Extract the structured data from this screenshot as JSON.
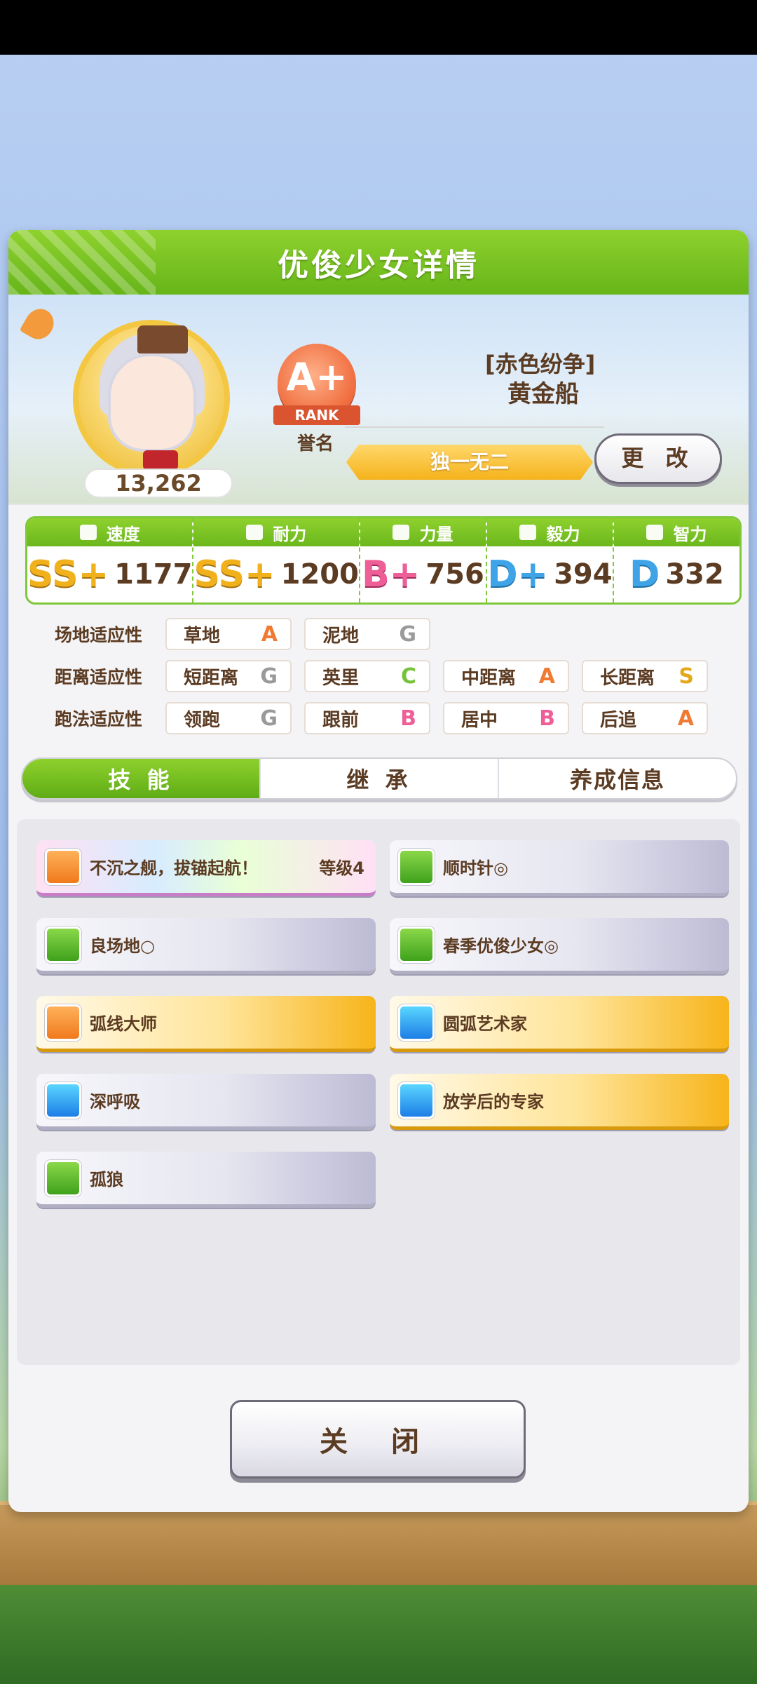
{
  "header": {
    "title": "优俊少女详情"
  },
  "profile": {
    "score": "13,262",
    "rank_grade": "A+",
    "rank_ribbon": "RANK",
    "rank_caption": "誉名",
    "epithet": "[赤色纷争]",
    "name": "黄金船",
    "unique_label": "独一无二",
    "change_label": "更 改"
  },
  "stats": [
    {
      "label": "速度",
      "grade": "SS+",
      "value": "1177",
      "icon": "shoe-icon"
    },
    {
      "label": "耐力",
      "grade": "SS+",
      "value": "1200",
      "icon": "heart-icon"
    },
    {
      "label": "力量",
      "grade": "B+",
      "value": "756",
      "icon": "muscle-icon"
    },
    {
      "label": "毅力",
      "grade": "D+",
      "value": "394",
      "icon": "flame-icon"
    },
    {
      "label": "智力",
      "grade": "D",
      "value": "332",
      "icon": "graduation-cap-icon"
    }
  ],
  "aptitude": {
    "track": {
      "label": "场地适应性",
      "cells": [
        {
          "name": "草地",
          "grade": "A"
        },
        {
          "name": "泥地",
          "grade": "G"
        }
      ]
    },
    "distance": {
      "label": "距离适应性",
      "cells": [
        {
          "name": "短距离",
          "grade": "G"
        },
        {
          "name": "英里",
          "grade": "C"
        },
        {
          "name": "中距离",
          "grade": "A"
        },
        {
          "name": "长距离",
          "grade": "S"
        }
      ]
    },
    "style": {
      "label": "跑法适应性",
      "cells": [
        {
          "name": "领跑",
          "grade": "G"
        },
        {
          "name": "跟前",
          "grade": "B"
        },
        {
          "name": "居中",
          "grade": "B"
        },
        {
          "name": "后追",
          "grade": "A"
        }
      ]
    }
  },
  "tabs": [
    "技 能",
    "继 承",
    "养成信息"
  ],
  "skills": [
    {
      "name": "不沉之舰，拔锚起航！",
      "level": "等级4",
      "style": "rainbow",
      "icon": "unique-skill-icon"
    },
    {
      "name": "顺时针◎",
      "style": "white",
      "icon": "green-skill-icon"
    },
    {
      "name": "良场地○",
      "style": "white",
      "icon": "green-skill-icon"
    },
    {
      "name": "春季优俊少女◎",
      "style": "white",
      "icon": "green-skill-icon"
    },
    {
      "name": "弧线大师",
      "style": "gold",
      "icon": "orange-skill-icon"
    },
    {
      "name": "圆弧艺术家",
      "style": "gold",
      "icon": "blue-skill-icon"
    },
    {
      "name": "深呼吸",
      "style": "white",
      "icon": "blue-skill-icon"
    },
    {
      "name": "放学后的专家",
      "style": "gold",
      "icon": "blue-skill-icon"
    },
    {
      "name": "孤狼",
      "style": "white",
      "icon": "green-skill-icon"
    }
  ],
  "close_label": "关 闭"
}
